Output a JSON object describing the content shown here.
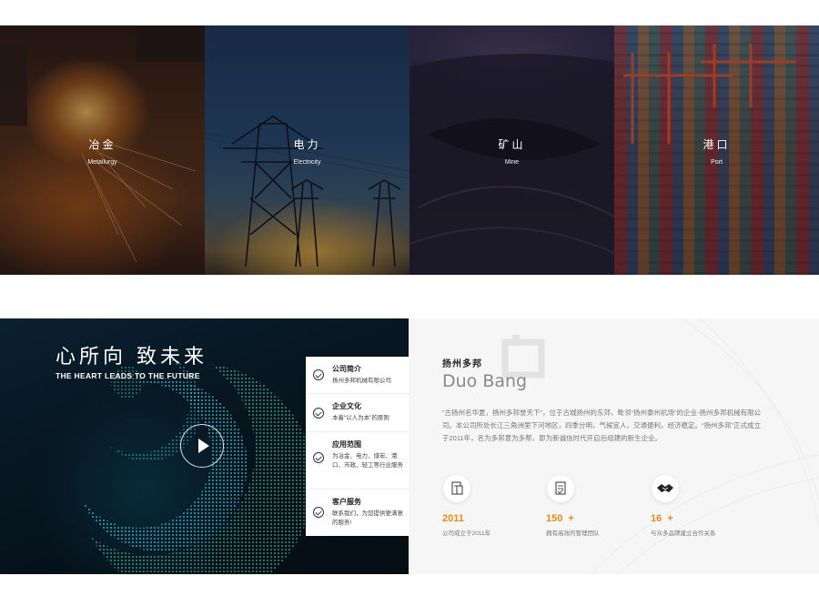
{
  "industries": [
    {
      "title": "冶金",
      "subtitle": "Metallurgy"
    },
    {
      "title": "电力",
      "subtitle": "Electricity"
    },
    {
      "title": "矿山",
      "subtitle": "Mine"
    },
    {
      "title": "港口",
      "subtitle": "Port"
    }
  ],
  "promo": {
    "title": "心所向  致未来",
    "subtitle": "THE HEART LEADS TO THE FUTURE"
  },
  "menu": [
    {
      "title": "公司简介",
      "desc": "扬州多邦机械有限公司"
    },
    {
      "title": "企业文化",
      "desc": "本着“以人为本”的原则"
    },
    {
      "title": "应用范围",
      "desc": "为冶金、电力、煤炭、港口、市政、轻工等行业服务"
    },
    {
      "title": "客户服务",
      "desc": "联系我们，为您提供更满意的服务!"
    }
  ],
  "about": {
    "title_cn": "扬州多邦",
    "title_en": "Duo Bang",
    "description": "“古扬州名华夏，扬州多邦誉天下”，位于古城扬州的东郊，毗邻“扬州泰州机场”的企业-扬州多邦机械有限公司。本公司所处长江三角洲里下河地区，四季分明，气候宜人，交通便利，经济稳定。“扬州多邦”正式成立于2011年，名为多邦意为多帮，即为新诚信时代开启后组建的新生企业。"
  },
  "stats": [
    {
      "icon": "document-icon",
      "number": "2011",
      "plus": "",
      "label": "公司成立于2011年"
    },
    {
      "icon": "clipboard-icon",
      "number": "150",
      "plus": "+",
      "label": "拥有高效的管理团队"
    },
    {
      "icon": "handshake-icon",
      "number": "16",
      "plus": "+",
      "label": "与众多品牌建立合作关系"
    }
  ],
  "colors": {
    "accent": "#e98a1c",
    "promo_bg": "#071620",
    "about_bg": "#f6f6f6"
  }
}
